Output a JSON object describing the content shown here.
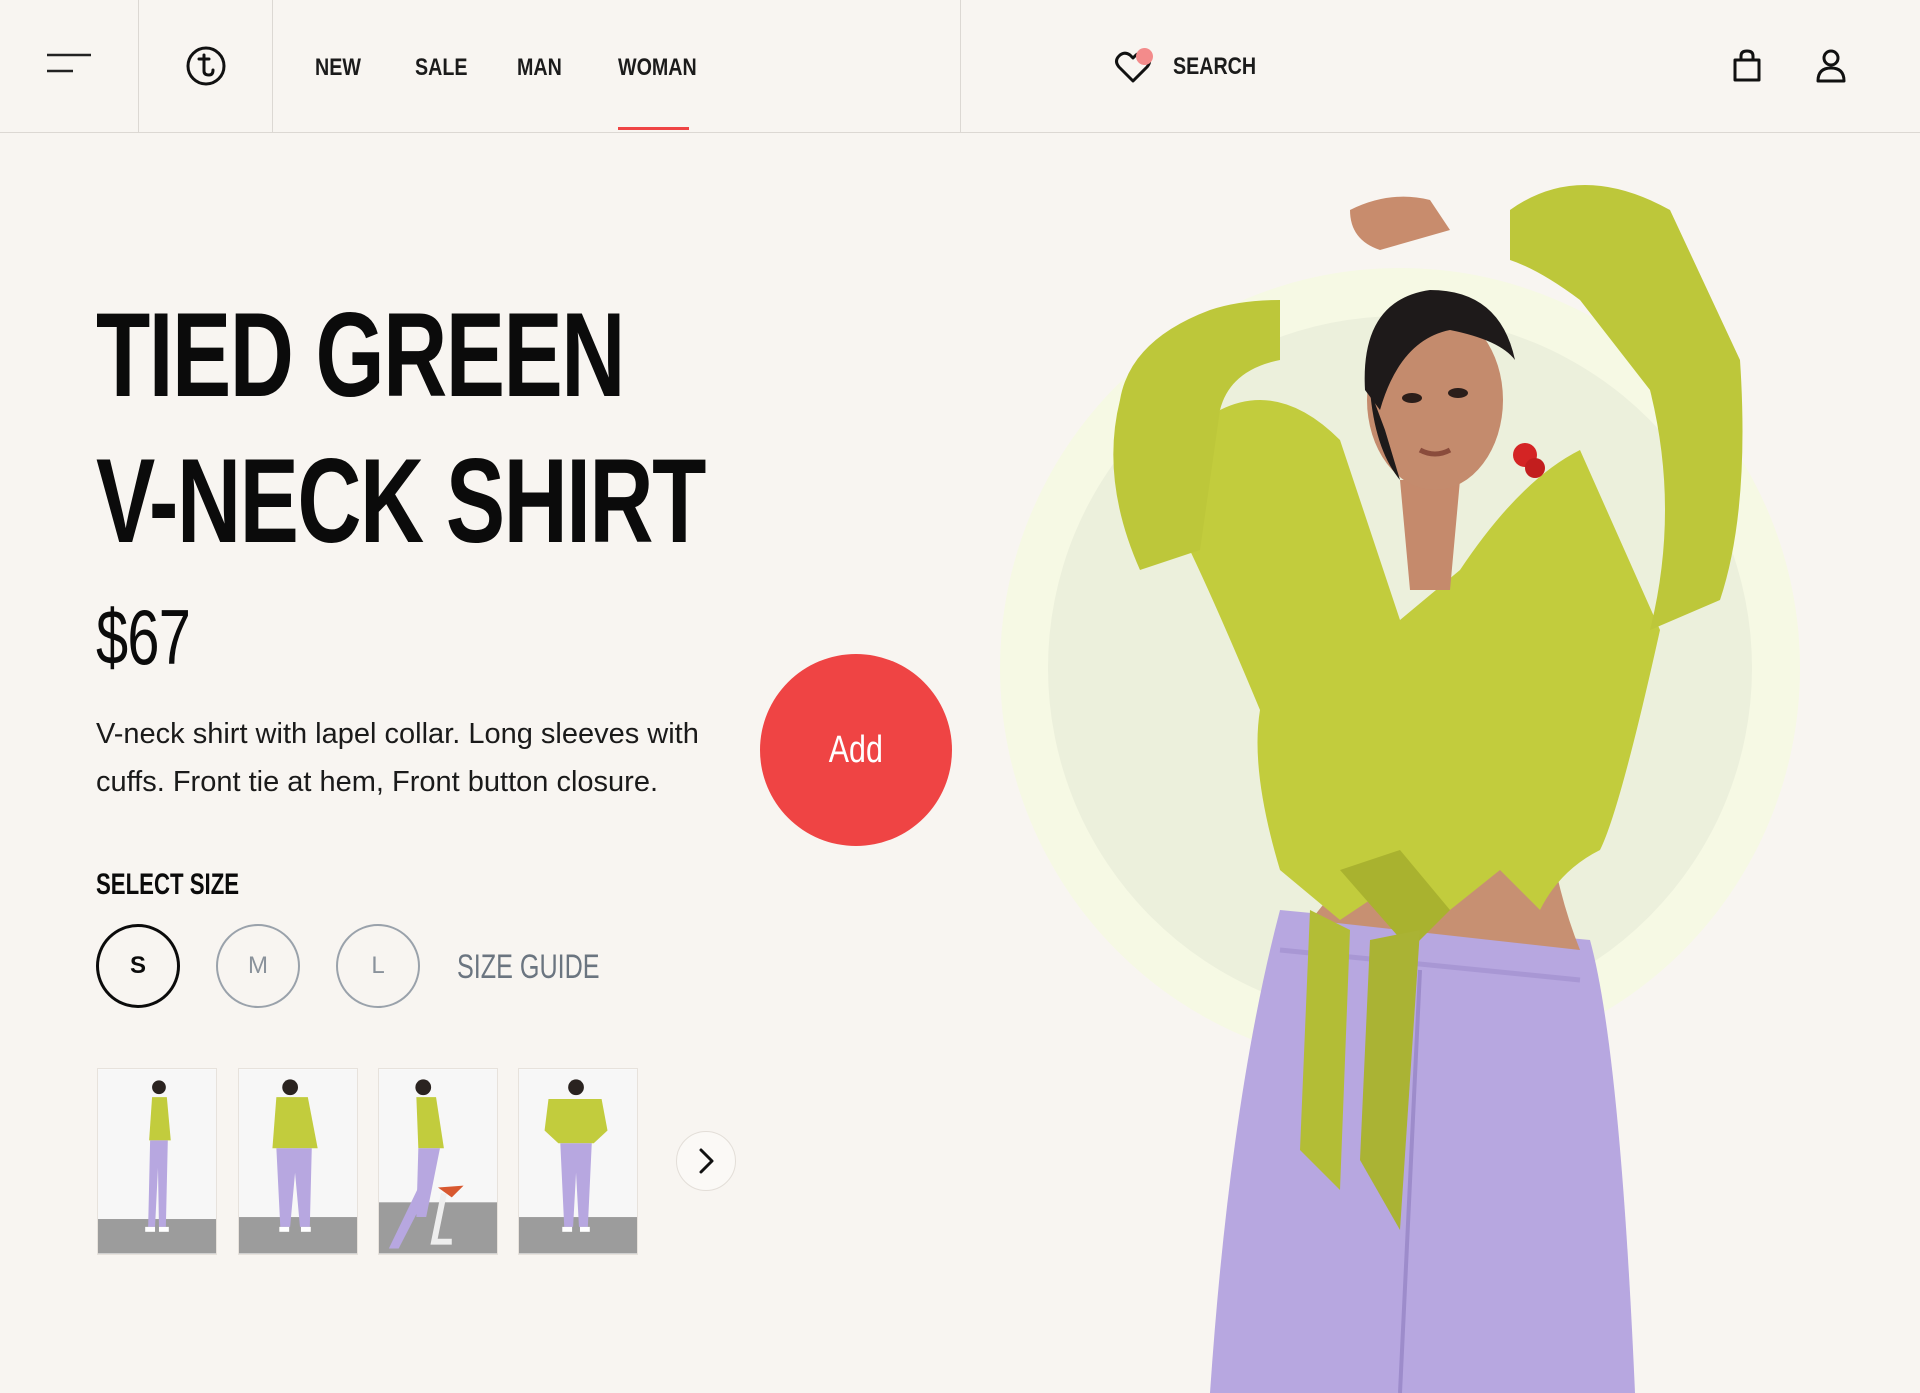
{
  "nav": {
    "items": [
      {
        "label": "NEW"
      },
      {
        "label": "SALE"
      },
      {
        "label": "MAN"
      },
      {
        "label": "WOMAN",
        "active": true
      }
    ],
    "search_label": "SEARCH",
    "icons": [
      "menu-icon",
      "logo-icon",
      "heart-icon",
      "bag-icon",
      "user-icon"
    ]
  },
  "product": {
    "title_line1": "TIED GREEN",
    "title_line2": "V-NECK SHIRT",
    "price": "$67",
    "description": "V-neck shirt with lapel collar. Long sleeves with cuffs. Front tie at hem, Front button closure.",
    "add_label": "Add",
    "size_heading": "SELECT SIZE",
    "sizes": [
      {
        "label": "S",
        "selected": true
      },
      {
        "label": "M",
        "selected": false
      },
      {
        "label": "L",
        "selected": false
      }
    ],
    "size_guide_label": "SIZE GUIDE",
    "thumbnail_count": 4
  },
  "colors": {
    "accent": "#ef4444",
    "background": "#f8f5f1",
    "shirt": "#c2cc3d",
    "pants": "#b7a7e0",
    "circle": "#eef2dd"
  }
}
